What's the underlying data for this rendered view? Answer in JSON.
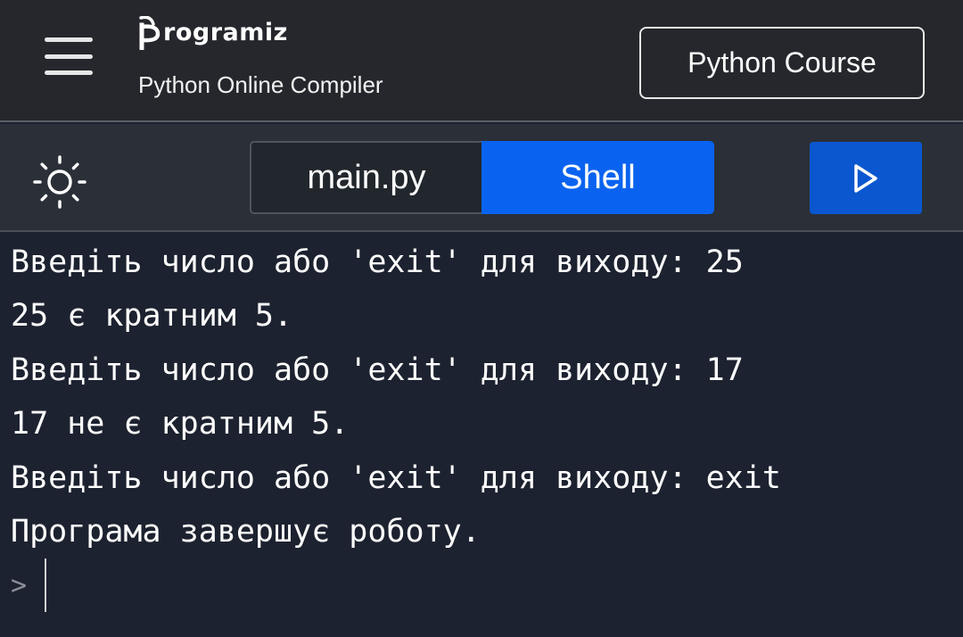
{
  "header": {
    "brand": "rogramiz",
    "subtitle": "Python Online Compiler",
    "course_label": "Python Course"
  },
  "toolbar": {
    "tabs": [
      {
        "label": "main.py",
        "active": false
      },
      {
        "label": "Shell",
        "active": true
      }
    ],
    "theme_icon": "sun-icon",
    "run_icon": "play-icon"
  },
  "console": {
    "lines": [
      "Введіть число або 'exit' для виходу: 25",
      "25 є кратним 5.",
      "Введіть число або 'exit' для виходу: 17",
      "17 не є кратним 5.",
      "Введіть число або 'exit' для виходу: exit",
      "Програма завершує роботу."
    ],
    "prompt": ">"
  },
  "colors": {
    "accent": "#0a63f0",
    "run": "#0b57d0",
    "header_bg": "#25272c",
    "console_bg": "#1d2230"
  }
}
